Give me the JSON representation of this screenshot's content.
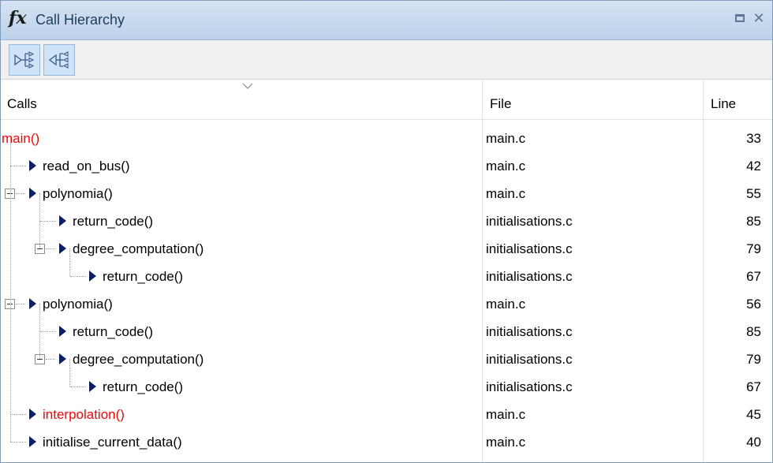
{
  "window": {
    "fx_symbol": "fx",
    "title": "Call Hierarchy"
  },
  "toolbar": {
    "buttons": [
      {
        "name": "show-callees",
        "icon": "callees-icon"
      },
      {
        "name": "show-callers",
        "icon": "callers-icon"
      }
    ]
  },
  "columns": {
    "calls": "Calls",
    "file": "File",
    "line": "Line"
  },
  "rows": [
    {
      "call": "main()",
      "file": "main.c",
      "line": "33",
      "depth": 0,
      "expander": false,
      "arrow": false,
      "red": true
    },
    {
      "call": "read_on_bus()",
      "file": "main.c",
      "line": "42",
      "depth": 1,
      "expander": false,
      "arrow": true,
      "red": false
    },
    {
      "call": "polynomia()",
      "file": "main.c",
      "line": "55",
      "depth": 1,
      "expander": true,
      "arrow": true,
      "red": false
    },
    {
      "call": "return_code()",
      "file": "initialisations.c",
      "line": "85",
      "depth": 2,
      "expander": false,
      "arrow": true,
      "red": false
    },
    {
      "call": "degree_computation()",
      "file": "initialisations.c",
      "line": "79",
      "depth": 2,
      "expander": true,
      "arrow": true,
      "red": false
    },
    {
      "call": "return_code()",
      "file": "initialisations.c",
      "line": "67",
      "depth": 3,
      "expander": false,
      "arrow": true,
      "red": false
    },
    {
      "call": "polynomia()",
      "file": "main.c",
      "line": "56",
      "depth": 1,
      "expander": true,
      "arrow": true,
      "red": false
    },
    {
      "call": "return_code()",
      "file": "initialisations.c",
      "line": "85",
      "depth": 2,
      "expander": false,
      "arrow": true,
      "red": false
    },
    {
      "call": "degree_computation()",
      "file": "initialisations.c",
      "line": "79",
      "depth": 2,
      "expander": true,
      "arrow": true,
      "red": false
    },
    {
      "call": "return_code()",
      "file": "initialisations.c",
      "line": "67",
      "depth": 3,
      "expander": false,
      "arrow": true,
      "red": false
    },
    {
      "call": "interpolation()",
      "file": "main.c",
      "line": "45",
      "depth": 1,
      "expander": false,
      "arrow": true,
      "red": true
    },
    {
      "call": "initialise_current_data()",
      "file": "main.c",
      "line": "40",
      "depth": 1,
      "expander": false,
      "arrow": true,
      "red": false
    }
  ],
  "colors": {
    "red_text": "#ff0000",
    "arrow": "#0a1f6b",
    "titlebar": "#c6d9ef"
  }
}
